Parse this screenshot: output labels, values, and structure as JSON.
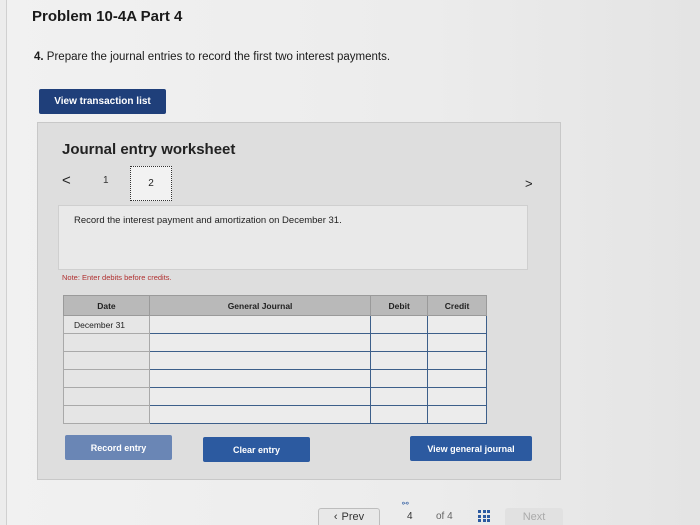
{
  "header": {
    "title": "Problem 10-4A Part 4",
    "instruction_number": "4.",
    "instruction_text": "Prepare the journal entries to record the first two interest payments."
  },
  "view_transaction_list_label": "View transaction list",
  "worksheet": {
    "title": "Journal entry worksheet",
    "prev_icon": "chevron-left-icon",
    "next_icon": "chevron-right-icon",
    "pages": [
      "1",
      "2"
    ],
    "selected_page": "2",
    "description": "Record the interest payment and amortization on December 31.",
    "note": "Note: Enter debits before credits.",
    "table": {
      "headers": [
        "Date",
        "General Journal",
        "Debit",
        "Credit"
      ],
      "rows": [
        {
          "date": "December 31",
          "general_journal": "",
          "debit": "",
          "credit": ""
        },
        {
          "date": "",
          "general_journal": "",
          "debit": "",
          "credit": ""
        },
        {
          "date": "",
          "general_journal": "",
          "debit": "",
          "credit": ""
        },
        {
          "date": "",
          "general_journal": "",
          "debit": "",
          "credit": ""
        },
        {
          "date": "",
          "general_journal": "",
          "debit": "",
          "credit": ""
        },
        {
          "date": "",
          "general_journal": "",
          "debit": "",
          "credit": ""
        }
      ]
    },
    "buttons": {
      "record": "Record entry",
      "clear": "Clear entry",
      "view_general_journal": "View general journal"
    }
  },
  "footer": {
    "prev_label": "Prev",
    "current_page": "4",
    "of_label": "of 4",
    "next_label": "Next"
  },
  "colors": {
    "primary_button": "#2c5aa0",
    "dark_button": "#1f3f7a",
    "entry_border": "#3d5f8a",
    "note_text": "#b03030"
  }
}
